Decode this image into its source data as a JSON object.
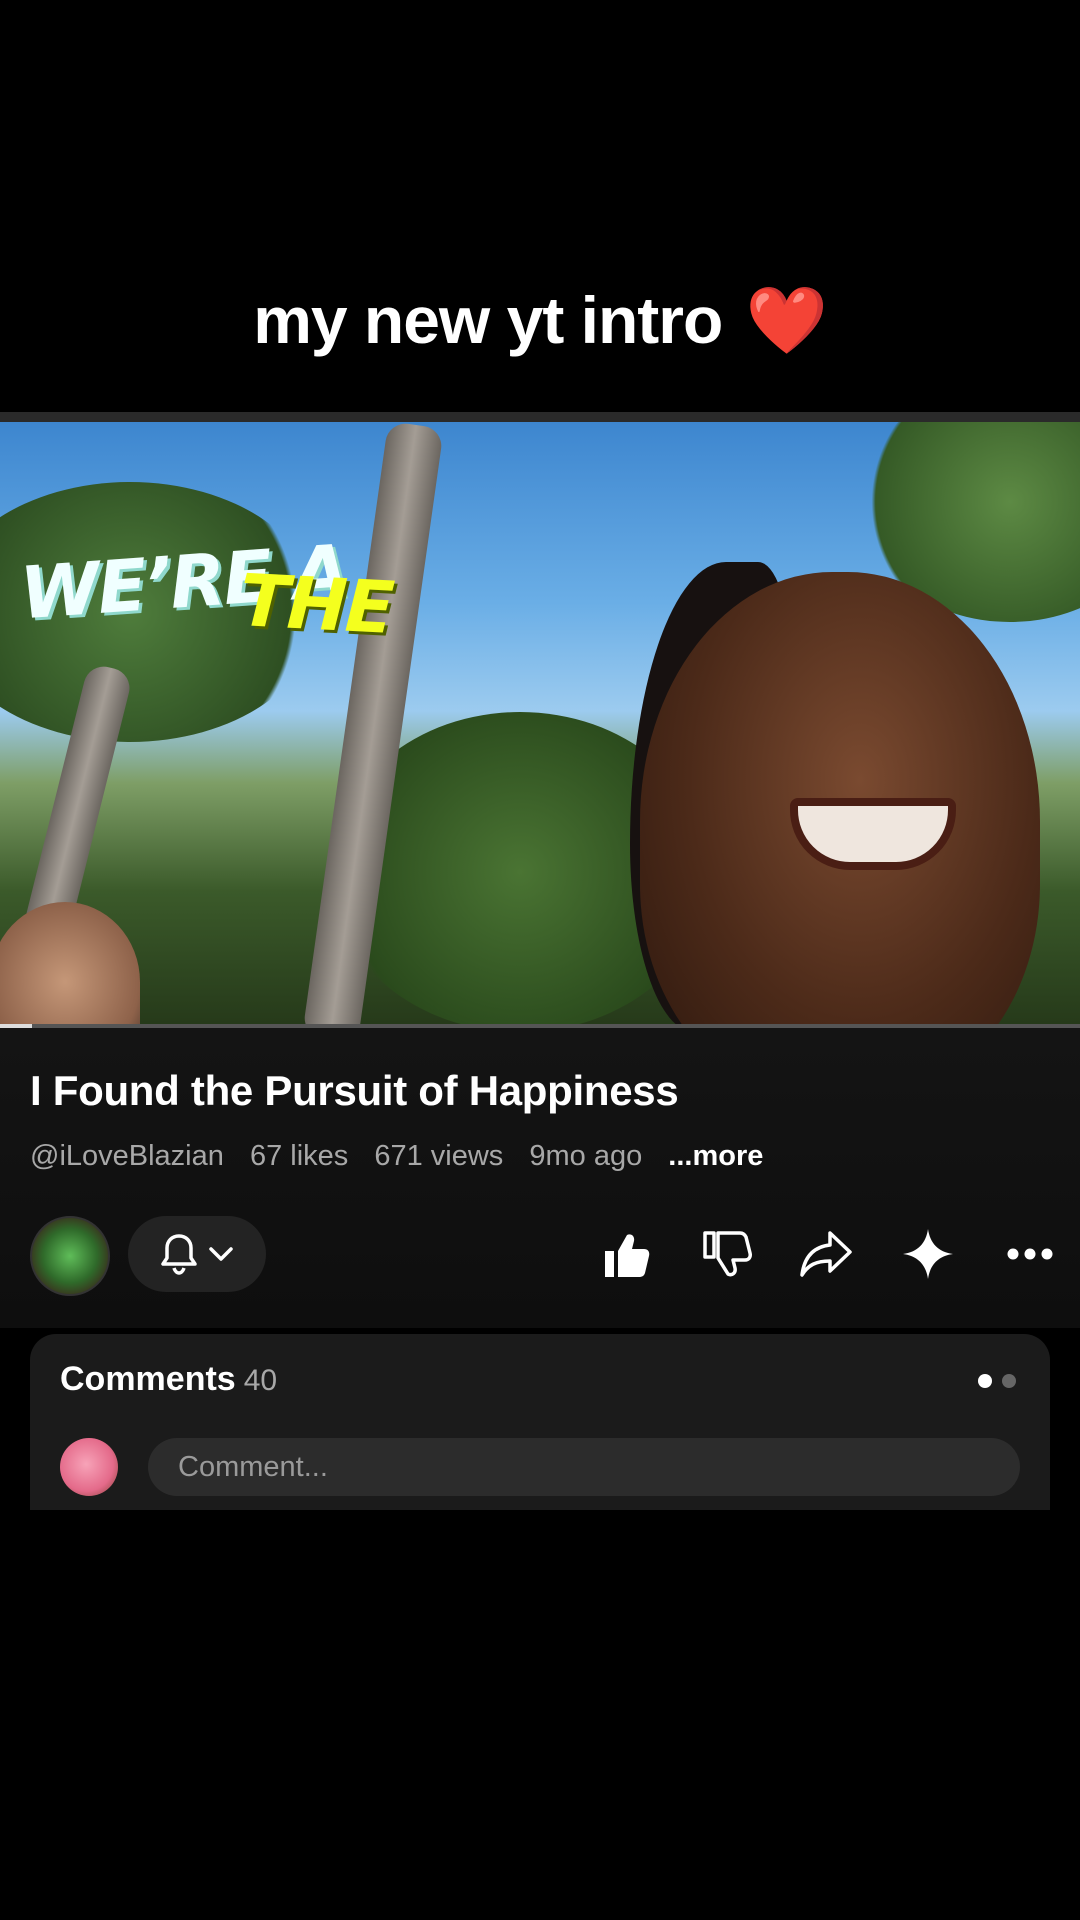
{
  "caption": {
    "text": "my new yt intro",
    "emoji": "❤️"
  },
  "video": {
    "overlay_text_1": "WE’RE A",
    "overlay_text_2": "THE",
    "progress_fraction": 0.03
  },
  "info": {
    "title": "I Found the Pursuit of Happiness",
    "channel": "@iLoveBlazian",
    "likes": "67 likes",
    "views": "671 views",
    "age": "9mo ago",
    "more": "...more"
  },
  "actions": {
    "icons": [
      "bell-icon",
      "chevron-down-icon",
      "thumbs-up-icon",
      "thumbs-down-icon",
      "share-icon",
      "sparkle-icon",
      "more-icon"
    ]
  },
  "comments": {
    "title": "Comments",
    "count": "40",
    "placeholder": "Comment..."
  },
  "colors": {
    "background": "#000000",
    "panel": "#1b1b1b",
    "accent_yellow": "#f4ff1e"
  }
}
